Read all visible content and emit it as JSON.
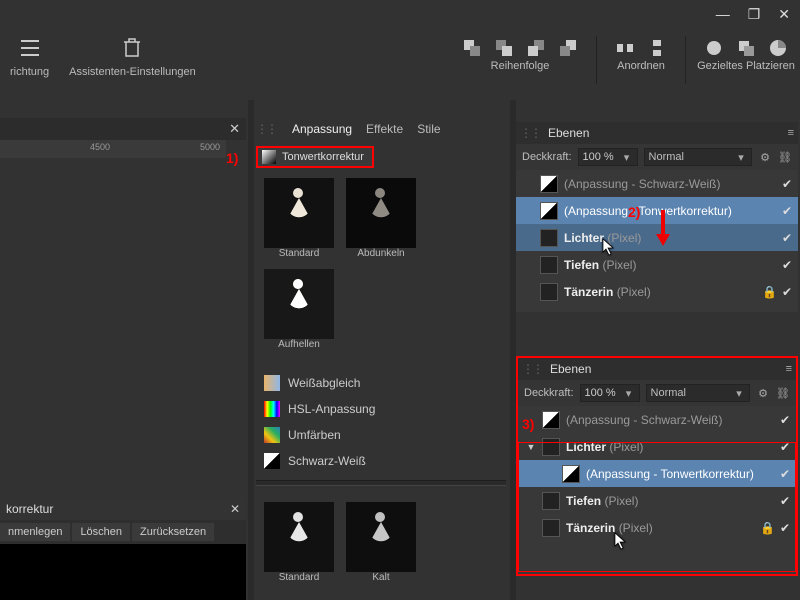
{
  "window": {
    "minimize": "—",
    "maximize": "❐",
    "close": "✕"
  },
  "toolbar": {
    "ausrichtung": "richtung",
    "assistenten": "Assistenten-Einstellungen",
    "reihenfolge": "Reihenfolge",
    "anordnen": "Anordnen",
    "platzieren": "Gezieltes Platzieren"
  },
  "ruler": {
    "t4500": "4500",
    "t5000": "5000"
  },
  "callouts": {
    "one": "1)",
    "two": "2)",
    "three": "3)"
  },
  "mid": {
    "tabs": {
      "anpassung": "Anpassung",
      "effekte": "Effekte",
      "stile": "Stile"
    },
    "preset_header": "Tonwertkorrektur",
    "thumbs": {
      "standard": "Standard",
      "abdunkeln": "Abdunkeln",
      "aufhellen": "Aufhellen",
      "kalt": "Kalt"
    },
    "adjust": {
      "wb": "Weißabgleich",
      "hsl": "HSL-Anpassung",
      "recolor": "Umfärben",
      "bw": "Schwarz-Weiß"
    }
  },
  "layers_top": {
    "title": "Ebenen",
    "opacity_label": "Deckkraft:",
    "opacity_value": "100 %",
    "blend": "Normal",
    "items": [
      {
        "name": "(Anpassung - Schwarz-Weiß)",
        "type": "adj"
      },
      {
        "name": "(Anpassung - Tonwertkorrektur)",
        "type": "adj"
      },
      {
        "name": "Lichter",
        "suffix": "(Pixel)",
        "type": "px"
      },
      {
        "name": "Tiefen",
        "suffix": "(Pixel)",
        "type": "px"
      },
      {
        "name": "Tänzerin",
        "suffix": "(Pixel)",
        "type": "px",
        "locked": true
      }
    ]
  },
  "layers_bot": {
    "title": "Ebenen",
    "opacity_label": "Deckkraft:",
    "opacity_value": "100 %",
    "blend": "Normal",
    "items": [
      {
        "name": "(Anpassung - Schwarz-Weiß)",
        "type": "adj"
      },
      {
        "name": "Lichter",
        "suffix": "(Pixel)",
        "type": "px",
        "expanded": true
      },
      {
        "name": "(Anpassung - Tonwertkorrektur)",
        "type": "adj",
        "child": true
      },
      {
        "name": "Tiefen",
        "suffix": "(Pixel)",
        "type": "px"
      },
      {
        "name": "Tänzerin",
        "suffix": "(Pixel)",
        "type": "px",
        "locked": true
      }
    ]
  },
  "bl": {
    "title": "korrektur",
    "merge": "nmenlegen",
    "delete": "Löschen",
    "reset": "Zurücksetzen"
  }
}
